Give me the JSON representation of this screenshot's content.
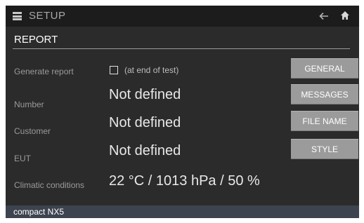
{
  "header": {
    "title": "SETUP",
    "menu_icon": "menu-icon",
    "back_icon": "back-arrow-icon",
    "home_icon": "home-icon"
  },
  "section": {
    "title": "REPORT"
  },
  "rows": [
    {
      "label": "Generate report",
      "checkbox_checked": false,
      "checkbox_label": "(at end of test)"
    },
    {
      "label": "Number",
      "value": "Not defined"
    },
    {
      "label": "Customer",
      "value": "Not defined"
    },
    {
      "label": "EUT",
      "value": "Not defined"
    },
    {
      "label": "Climatic conditions",
      "value": "22 °C / 1013 hPa / 50 %"
    }
  ],
  "buttons": [
    {
      "label": "GENERAL"
    },
    {
      "label": "MESSAGES"
    },
    {
      "label": "FILE NAME"
    },
    {
      "label": "STYLE"
    }
  ],
  "footer": {
    "device": "compact NX5"
  },
  "colors": {
    "background": "#2b2b2b",
    "titlebar": "#1c1c1c",
    "button": "#9b9b9b",
    "footer": "#3d4450",
    "label": "#9a9a9a",
    "value": "#e8e8e8"
  }
}
